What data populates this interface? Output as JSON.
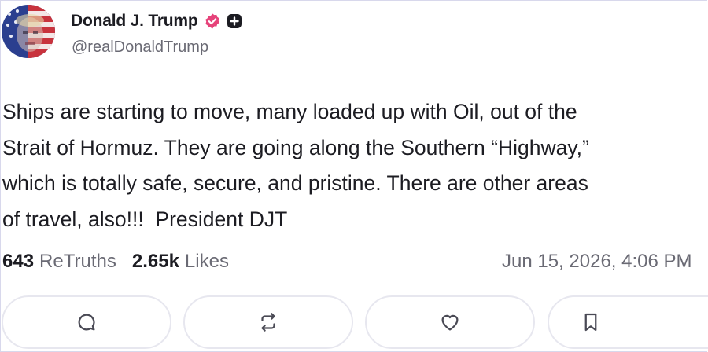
{
  "user": {
    "display_name": "Donald J. Trump",
    "handle": "@realDonaldTrump",
    "avatar_icon": "profile-photo-flag-overlay",
    "verified_icon": "verified-badge-icon",
    "verified_color": "#e6437a",
    "plus_icon": "plus-badge-icon"
  },
  "post": {
    "lines": [
      "Ships are starting to move, many loaded up with Oil, out of the",
      "Strait of Hormuz. They are going along the Southern “Highway,”",
      "which is totally safe, secure, and pristine. There are other areas",
      "of travel, also!!!  President DJT"
    ]
  },
  "stats": {
    "retruths_count": "643",
    "retruths_label": "ReTruths",
    "likes_count": "2.65k",
    "likes_label": "Likes",
    "timestamp": "Jun 15, 2026, 4:06 PM"
  },
  "actions": [
    {
      "icon": "reply-icon"
    },
    {
      "icon": "retruth-icon"
    },
    {
      "icon": "like-icon"
    },
    {
      "icon": "bookmark-icon"
    }
  ],
  "colors": {
    "text": "#1c1c22",
    "muted": "#6a6a74",
    "button_border": "#e7e7ef"
  }
}
